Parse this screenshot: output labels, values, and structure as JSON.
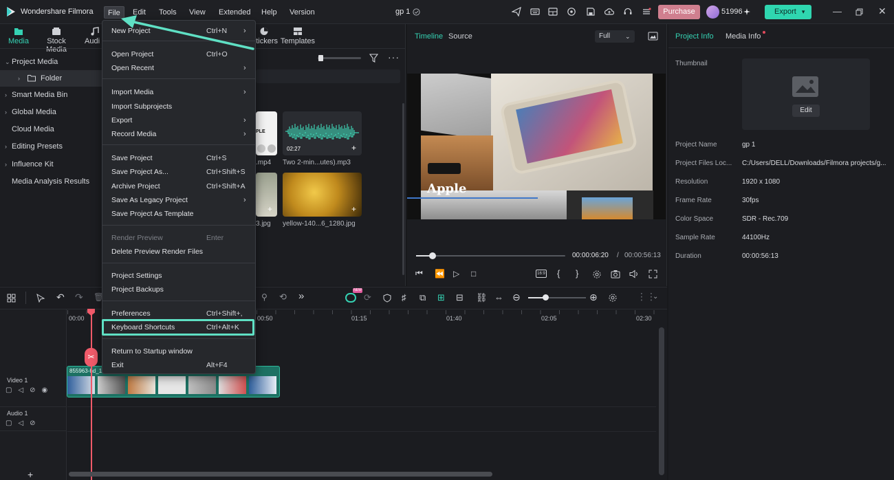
{
  "app": {
    "title": "Wondershare Filmora",
    "project_name": "gp 1",
    "credits": "51996",
    "purchase_label": "Purchase",
    "export_label": "Export",
    "accent": "#35d2b3"
  },
  "menubar": [
    "File",
    "Edit",
    "Tools",
    "View",
    "Extended",
    "Help",
    "Version"
  ],
  "media_tabs": [
    {
      "label": "Media",
      "icon": "media-folder-icon"
    },
    {
      "label": "Stock Media",
      "icon": "stock-media-icon"
    },
    {
      "label": "Audio",
      "icon": "music-note-icon"
    },
    {
      "label": "Stickers",
      "icon": "sticker-icon"
    },
    {
      "label": "Templates",
      "icon": "templates-icon"
    }
  ],
  "sidebar": [
    {
      "label": "Project Media",
      "chevron": "⌄"
    },
    {
      "label": "Folder",
      "chevron": "›"
    },
    {
      "label": "Smart Media Bin",
      "chevron": "›"
    },
    {
      "label": "Global Media",
      "chevron": "›"
    },
    {
      "label": "Cloud Media",
      "chevron": ""
    },
    {
      "label": "Editing Presets",
      "chevron": "›"
    },
    {
      "label": "Influence Kit",
      "chevron": "›"
    },
    {
      "label": "Media Analysis Results",
      "chevron": ""
    }
  ],
  "media_items": [
    {
      "label": ".mp4",
      "thumb_text": "PLE"
    },
    {
      "label": "Two 2-min...utes).mp3",
      "duration": "02:27"
    },
    {
      "label": "3.jpg"
    },
    {
      "label": "yellow-140...6_1280.jpg"
    }
  ],
  "file_menu": [
    {
      "label": "New Project",
      "shortcut": "Ctrl+N",
      "submenu": true
    },
    {
      "label": "Open Project",
      "shortcut": "Ctrl+O"
    },
    {
      "label": "Open Recent",
      "shortcut": "",
      "submenu": true
    },
    {
      "label": "Import Media",
      "shortcut": "",
      "submenu": true
    },
    {
      "label": "Import Subprojects",
      "shortcut": ""
    },
    {
      "label": "Export",
      "shortcut": "",
      "submenu": true
    },
    {
      "label": "Record Media",
      "shortcut": "",
      "submenu": true
    },
    {
      "label": "Save Project",
      "shortcut": "Ctrl+S"
    },
    {
      "label": "Save Project As...",
      "shortcut": "Ctrl+Shift+S"
    },
    {
      "label": "Archive Project",
      "shortcut": "Ctrl+Shift+A"
    },
    {
      "label": "Save As Legacy Project",
      "shortcut": "",
      "submenu": true
    },
    {
      "label": "Save Project As Template",
      "shortcut": ""
    },
    {
      "label": "Render Preview",
      "shortcut": "Enter",
      "disabled": true
    },
    {
      "label": "Delete Preview Render Files",
      "shortcut": ""
    },
    {
      "label": "Project Settings",
      "shortcut": ""
    },
    {
      "label": "Project Backups",
      "shortcut": ""
    },
    {
      "label": "Preferences",
      "shortcut": "Ctrl+Shift+,"
    },
    {
      "label": "Keyboard Shortcuts",
      "shortcut": "Ctrl+Alt+K"
    },
    {
      "label": "Return to Startup window",
      "shortcut": ""
    },
    {
      "label": "Exit",
      "shortcut": "Alt+F4"
    }
  ],
  "preview": {
    "tab_timeline": "Timeline",
    "tab_source": "Source",
    "quality": "Full",
    "overlay_text": "Apple",
    "current_time": "00:00:06:20",
    "separator": "/",
    "total_time": "00:00:56:13",
    "aspect_label": "16:9",
    "progress": 0.11
  },
  "info": {
    "tab_project": "Project Info",
    "tab_media": "Media Info",
    "thumbnail_label": "Thumbnail",
    "edit_label": "Edit",
    "fields": [
      {
        "label": "Project Name",
        "value": "gp 1"
      },
      {
        "label": "Project Files Loc...",
        "value": "C:/Users/DELL/Downloads/Filmora projects/g..."
      },
      {
        "label": "Resolution",
        "value": "1920 x 1080"
      },
      {
        "label": "Frame Rate",
        "value": "30fps"
      },
      {
        "label": "Color Space",
        "value": "SDR - Rec.709"
      },
      {
        "label": "Sample Rate",
        "value": "44100Hz"
      },
      {
        "label": "Duration",
        "value": "00:00:56:13"
      }
    ]
  },
  "timeline": {
    "ruler": [
      "00:00",
      "00:50",
      "01:15",
      "01:40",
      "02:05",
      "02:30"
    ],
    "tracks": [
      "Video 1",
      "Audio 1"
    ],
    "clip_name": "855963-hd_1",
    "ai_badge": "NEW"
  }
}
